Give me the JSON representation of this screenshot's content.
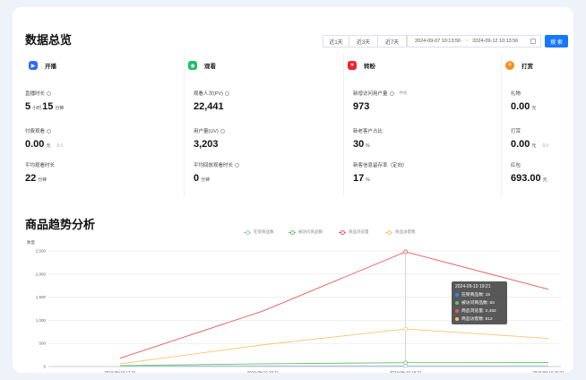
{
  "overview": {
    "title": "数据总览",
    "range_buttons": [
      "近1天",
      "近3天",
      "近7天"
    ],
    "date_start": "2024-09-07 10:13:56",
    "date_sep": "~",
    "date_end": "2024-09-12 10:13:56",
    "search_label": "搜 索"
  },
  "panels": [
    {
      "title": "开播",
      "icon": "broadcast-icon",
      "icon_color": "#2f6bff",
      "metrics": [
        {
          "label": "直播时长",
          "value1": "5",
          "unit1": "小时",
          "value2": "15",
          "unit2": "分钟"
        },
        {
          "label": "付费观看",
          "value1": "0.00",
          "unit1": "元",
          "note": "0人"
        },
        {
          "label": "平均观看时长",
          "value1": "22",
          "unit1": "分钟"
        }
      ]
    },
    {
      "title": "观看",
      "icon": "watch-icon",
      "icon_color": "#19be6b",
      "metrics": [
        {
          "label": "观看人次(PV)",
          "value1": "22,441"
        },
        {
          "label": "用户量(UV)",
          "value1": "3,203"
        },
        {
          "label": "平均回放观看时长",
          "value1": "0",
          "unit1": "分钟"
        }
      ]
    },
    {
      "title": "转粉",
      "icon": "fans-icon",
      "icon_color": "#f5222d",
      "metrics": [
        {
          "label": "新增访问用户量",
          "sub": "种植",
          "value1": "973"
        },
        {
          "label": "新老客户占比",
          "value1": "30",
          "unit1": "%"
        },
        {
          "label": "新客信息留存率（定向）",
          "value1": "17",
          "unit1": "%"
        }
      ]
    },
    {
      "title": "打赏",
      "icon": "reward-icon",
      "icon_color": "#fa8c16",
      "metrics": [
        {
          "label": "礼物",
          "value1": "0.00",
          "unit1": "元"
        },
        {
          "label": "打赏",
          "value1": "0.00",
          "unit1": "元",
          "note": "0人"
        },
        {
          "label": "红包",
          "value1": "693.00",
          "unit1": "元"
        }
      ]
    }
  ],
  "trend": {
    "title": "商品趋势分析"
  },
  "chart_data": {
    "type": "line",
    "ylabel": "数量",
    "ylim": [
      0,
      2500
    ],
    "yticks": [
      "0",
      "500",
      "1,000",
      "1,500",
      "2,000",
      "2,500"
    ],
    "x": [
      "2024-09-10 17:21",
      "2024-09-10 18:21",
      "2024-09-10 19:21",
      "2024-09-10 20:21"
    ],
    "legend_position": "top",
    "grid": true,
    "series": [
      {
        "name": "在架商品数",
        "color": "#9bc1e8",
        "values": [
          15,
          15,
          15,
          15
        ]
      },
      {
        "name": "被访问商品数",
        "color": "#66c266",
        "values": [
          20,
          60,
          83,
          85
        ]
      },
      {
        "name": "商品浏览量",
        "color": "#e85a5a",
        "values": [
          180,
          1200,
          2482,
          1670
        ]
      },
      {
        "name": "商品访客数",
        "color": "#f7c46c",
        "values": [
          60,
          470,
          812,
          610
        ]
      }
    ],
    "tooltip": {
      "title": "2024-09-10 19:21",
      "rows": [
        "在架商品数: 15",
        "被访问商品数: 83",
        "商品浏览量: 2,482",
        "商品访客数: 812"
      ]
    }
  }
}
